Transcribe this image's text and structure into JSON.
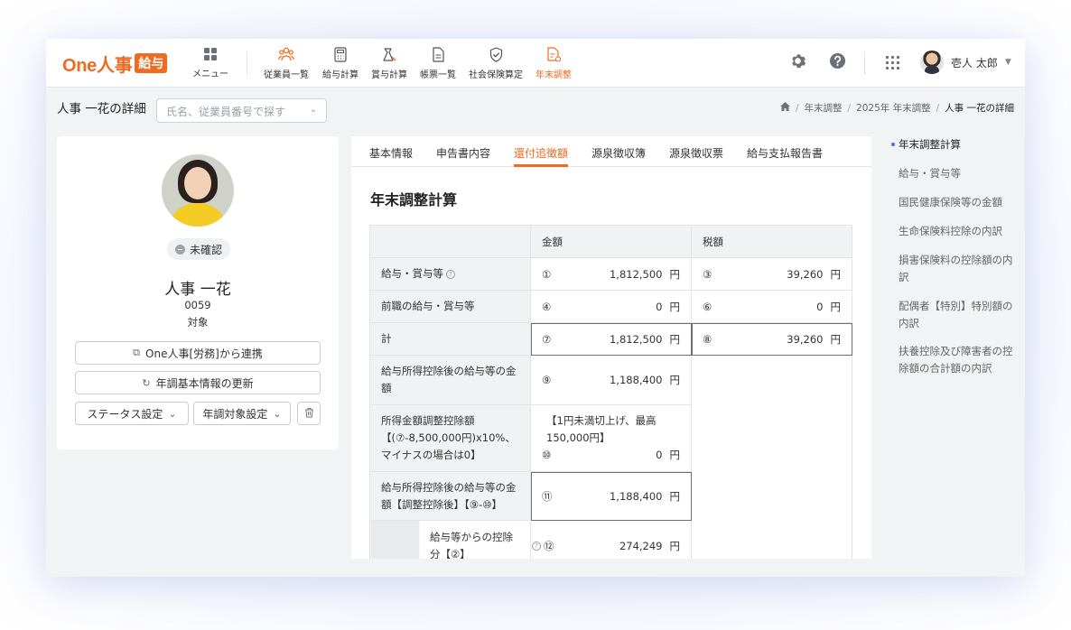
{
  "app": {
    "logo_text": "One人事",
    "logo_badge": "給与",
    "menu_label": "メニュー",
    "nav": [
      {
        "label": "従業員一覧",
        "icon": "people-icon"
      },
      {
        "label": "給与計算",
        "icon": "calculator-icon"
      },
      {
        "label": "賞与計算",
        "icon": "bonus-calc-icon"
      },
      {
        "label": "帳票一覧",
        "icon": "document-icon"
      },
      {
        "label": "社会保険算定",
        "icon": "shield-check-icon"
      },
      {
        "label": "年末調整",
        "icon": "year-end-icon"
      }
    ],
    "user_name": "壱人 太郎",
    "accent_color": "#f06a20"
  },
  "page": {
    "title": "人事 一花の詳細",
    "search_placeholder": "氏名、従業員番号で探す",
    "breadcrumb": [
      "年末調整",
      "2025年 年末調整",
      "人事 一花の詳細"
    ]
  },
  "employee": {
    "status": "未確認",
    "name": "人事 一花",
    "number": "0059",
    "target": "対象",
    "link_button": "One人事[労務]から連携",
    "update_button": "年調基本情報の更新",
    "status_setting": "ステータス設定",
    "target_setting": "年調対象設定"
  },
  "tabs": [
    "基本情報",
    "申告書内容",
    "還付追徴額",
    "源泉徴収簿",
    "源泉徴収票",
    "給与支払報告書"
  ],
  "active_tab": "還付追徴額",
  "section": {
    "title": "年末調整計算",
    "col_amount": "金額",
    "col_tax": "税額",
    "yen": "円",
    "rows": {
      "r1": {
        "label": "給与・賞与等",
        "amt_no": "①",
        "amt": "1,812,500",
        "tax_no": "③",
        "tax": "39,260"
      },
      "r2": {
        "label": "前職の給与・賞与等",
        "amt_no": "④",
        "amt": "0",
        "tax_no": "⑥",
        "tax": "0"
      },
      "r3": {
        "label": "計",
        "amt_no": "⑦",
        "amt": "1,812,500",
        "tax_no": "⑧",
        "tax": "39,260"
      },
      "r4": {
        "label": "給与所得控除後の給与等の金額",
        "amt_no": "⑨",
        "amt": "1,188,400"
      },
      "r5": {
        "label": "所得金額調整控除額【(⑦-8,500,000円)x10%、マイナスの場合は0】",
        "note": "【1円未満切上げ、最高150,000円】",
        "amt_no": "⑩",
        "amt": "0"
      },
      "r6": {
        "label": "給与所得控除後の給与等の金額【調整控除後】【⑨-⑩】",
        "amt_no": "⑪",
        "amt": "1,188,400"
      },
      "r7": {
        "label": "給与等からの控除分【②】",
        "amt_no": "⑫",
        "amt": "274,249"
      }
    }
  },
  "right_nav": [
    "年末調整計算",
    "給与・賞与等",
    "国民健康保険等の金額",
    "生命保険料控除の内訳",
    "損害保険料の控除額の内訳",
    "配偶者【特別】特別額の内訳",
    "扶養控除及び障害者の控除額の合計額の内訳"
  ]
}
